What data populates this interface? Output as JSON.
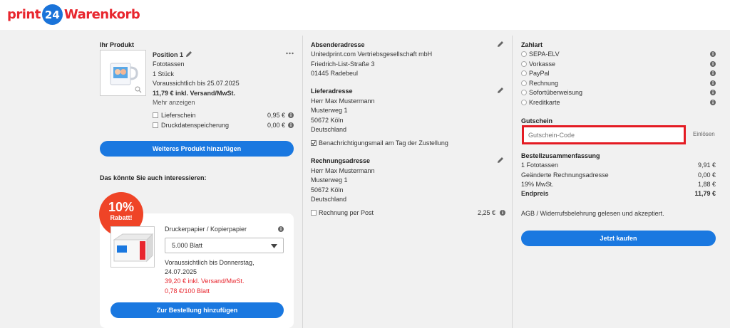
{
  "header": {
    "logo_print": "print",
    "logo_24": "24",
    "logo_cart": "Warenkorb"
  },
  "product": {
    "section_title": "Ihr Produkt",
    "position_label": "Position 1",
    "name": "Fototassen",
    "quantity": "1 Stück",
    "delivery": "Voraussichtlich bis 25.07.2025",
    "price": "11,79 € inkl. Versand/MwSt.",
    "more_link": "Mehr anzeigen",
    "options": [
      {
        "label": "Lieferschein",
        "price": "0,95 €"
      },
      {
        "label": "Druckdatenspeicherung",
        "price": "0,00 €"
      }
    ],
    "add_button": "Weiteres Produkt hinzufügen"
  },
  "recommend": {
    "title": "Das könnte Sie auch interessieren:",
    "badge_percent": "10%",
    "badge_text": "Rabatt!",
    "product_name": "Druckerpapier / Kopierpapier",
    "select_value": "5.000 Blatt",
    "delivery_line1": "Voraussichtlich bis Donnerstag,",
    "delivery_line2": "24.07.2025",
    "price": "39,20 € inkl. Versand/MwSt.",
    "unit_price": "0,78 €/100 Blatt",
    "order_button": "Zur Bestellung hinzufügen"
  },
  "sender": {
    "title": "Absenderadresse",
    "lines": [
      "Unitedprint.com Vertriebsgesellschaft mbH",
      "Friedrich-List-Straße 3",
      "01445 Radebeul"
    ]
  },
  "delivery_address": {
    "title": "Lieferadresse",
    "lines": [
      "Herr Max Mustermann",
      "Musterweg 1",
      "50672 Köln",
      "Deutschland"
    ],
    "notify_label": "Benachrichtigungsmail am Tag der Zustellung"
  },
  "billing_address": {
    "title": "Rechnungsadresse",
    "lines": [
      "Herr Max Mustermann",
      "Musterweg 1",
      "50672 Köln",
      "Deutschland"
    ],
    "post_label": "Rechnung per Post",
    "post_price": "2,25 €"
  },
  "payment": {
    "title": "Zahlart",
    "options": [
      "SEPA-ELV",
      "Vorkasse",
      "PayPal",
      "Rechnung",
      "Sofortüberweisung",
      "Kreditkarte"
    ]
  },
  "voucher": {
    "title": "Gutschein",
    "placeholder": "Gutschein-Code",
    "redeem_label": "Einlösen"
  },
  "summary": {
    "title": "Bestellzusammenfassung",
    "rows": [
      {
        "label": "1 Fototassen",
        "value": "9,91 €"
      },
      {
        "label": "Geänderte Rechnungsadresse",
        "value": "0,00 €"
      },
      {
        "label": "19% MwSt.",
        "value": "1,88 €"
      }
    ],
    "total_label": "Endpreis",
    "total_value": "11,79 €",
    "terms": "AGB / Widerrufsbelehrung gelesen und akzeptiert.",
    "buy_button": "Jetzt kaufen"
  },
  "colors": {
    "brand_red": "#e8262e",
    "brand_blue": "#1a78e0",
    "highlight_red": "#e41b23"
  }
}
